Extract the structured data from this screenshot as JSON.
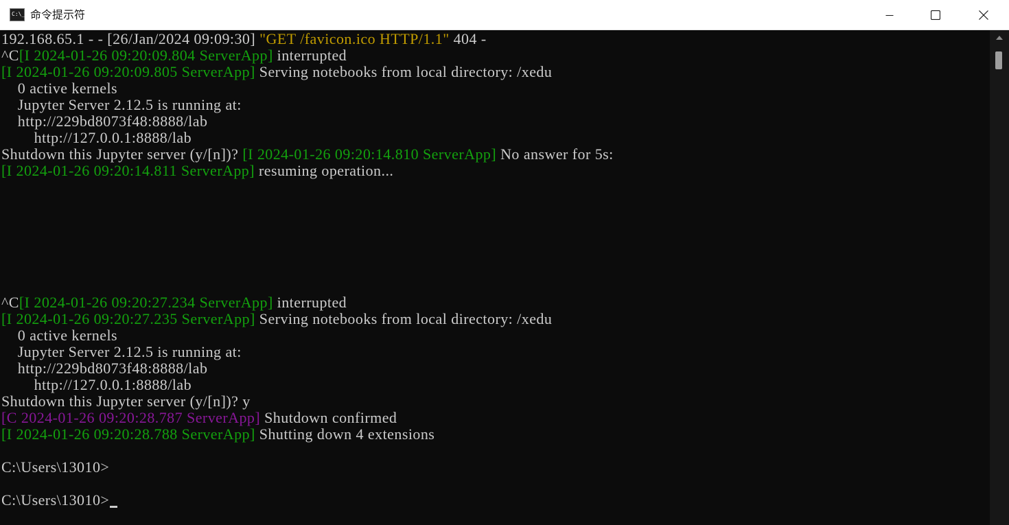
{
  "window": {
    "title": "命令提示符",
    "icon": "cmd-icon",
    "icon_glyph": "C:\\_"
  },
  "controls": {
    "minimize_icon": "minimize-icon",
    "maximize_icon": "maximize-icon",
    "close_icon": "close-icon"
  },
  "colors": {
    "background": "#0c0c0c",
    "text": "#cccccc",
    "green": "#13a10e",
    "yellow": "#c19c00",
    "magenta": "#881798"
  },
  "console": {
    "lines": [
      {
        "segments": [
          {
            "text": "192.168.65.1 - - [26/Jan/2024 09:09:30] ",
            "color": "default"
          },
          {
            "text": "\"GET /favicon.ico HTTP/1.1\"",
            "color": "yellow"
          },
          {
            "text": " 404 -",
            "color": "default"
          }
        ]
      },
      {
        "segments": [
          {
            "text": "^C",
            "color": "default"
          },
          {
            "text": "[I 2024-01-26 09:20:09.804 ServerApp]",
            "color": "green"
          },
          {
            "text": " interrupted",
            "color": "default"
          }
        ]
      },
      {
        "segments": [
          {
            "text": "[I 2024-01-26 09:20:09.805 ServerApp]",
            "color": "green"
          },
          {
            "text": " Serving notebooks from local directory: /xedu",
            "color": "default"
          }
        ]
      },
      {
        "segments": [
          {
            "text": "    0 active kernels",
            "color": "default"
          }
        ]
      },
      {
        "segments": [
          {
            "text": "    Jupyter Server 2.12.5 is running at:",
            "color": "default"
          }
        ]
      },
      {
        "segments": [
          {
            "text": "    http://229bd8073f48:8888/lab",
            "color": "default"
          }
        ]
      },
      {
        "segments": [
          {
            "text": "        http://127.0.0.1:8888/lab",
            "color": "default"
          }
        ]
      },
      {
        "segments": [
          {
            "text": "Shutdown this Jupyter server (y/[n])? ",
            "color": "default"
          },
          {
            "text": "[I 2024-01-26 09:20:14.810 ServerApp]",
            "color": "green"
          },
          {
            "text": " No answer for 5s:",
            "color": "default"
          }
        ]
      },
      {
        "segments": [
          {
            "text": "[I 2024-01-26 09:20:14.811 ServerApp]",
            "color": "green"
          },
          {
            "text": " resuming operation...",
            "color": "default"
          }
        ]
      },
      {
        "segments": []
      },
      {
        "segments": []
      },
      {
        "segments": []
      },
      {
        "segments": []
      },
      {
        "segments": []
      },
      {
        "segments": []
      },
      {
        "segments": []
      },
      {
        "segments": [
          {
            "text": "^C",
            "color": "default"
          },
          {
            "text": "[I 2024-01-26 09:20:27.234 ServerApp]",
            "color": "green"
          },
          {
            "text": " interrupted",
            "color": "default"
          }
        ]
      },
      {
        "segments": [
          {
            "text": "[I 2024-01-26 09:20:27.235 ServerApp]",
            "color": "green"
          },
          {
            "text": " Serving notebooks from local directory: /xedu",
            "color": "default"
          }
        ]
      },
      {
        "segments": [
          {
            "text": "    0 active kernels",
            "color": "default"
          }
        ]
      },
      {
        "segments": [
          {
            "text": "    Jupyter Server 2.12.5 is running at:",
            "color": "default"
          }
        ]
      },
      {
        "segments": [
          {
            "text": "    http://229bd8073f48:8888/lab",
            "color": "default"
          }
        ]
      },
      {
        "segments": [
          {
            "text": "        http://127.0.0.1:8888/lab",
            "color": "default"
          }
        ]
      },
      {
        "segments": [
          {
            "text": "Shutdown this Jupyter server (y/[n])? y",
            "color": "default"
          }
        ]
      },
      {
        "segments": [
          {
            "text": "[C 2024-01-26 09:20:28.787 ServerApp]",
            "color": "magenta"
          },
          {
            "text": " Shutdown confirmed",
            "color": "default"
          }
        ]
      },
      {
        "segments": [
          {
            "text": "[I 2024-01-26 09:20:28.788 ServerApp]",
            "color": "green"
          },
          {
            "text": " Shutting down 4 extensions",
            "color": "default"
          }
        ]
      },
      {
        "segments": []
      },
      {
        "segments": [
          {
            "text": "C:\\Users\\13010>",
            "color": "default"
          }
        ]
      },
      {
        "segments": []
      },
      {
        "segments": [
          {
            "text": "C:\\Users\\13010>",
            "color": "default"
          }
        ],
        "cursor": true
      }
    ]
  },
  "scrollbar": {
    "up_icon": "scroll-up-arrow-icon"
  }
}
